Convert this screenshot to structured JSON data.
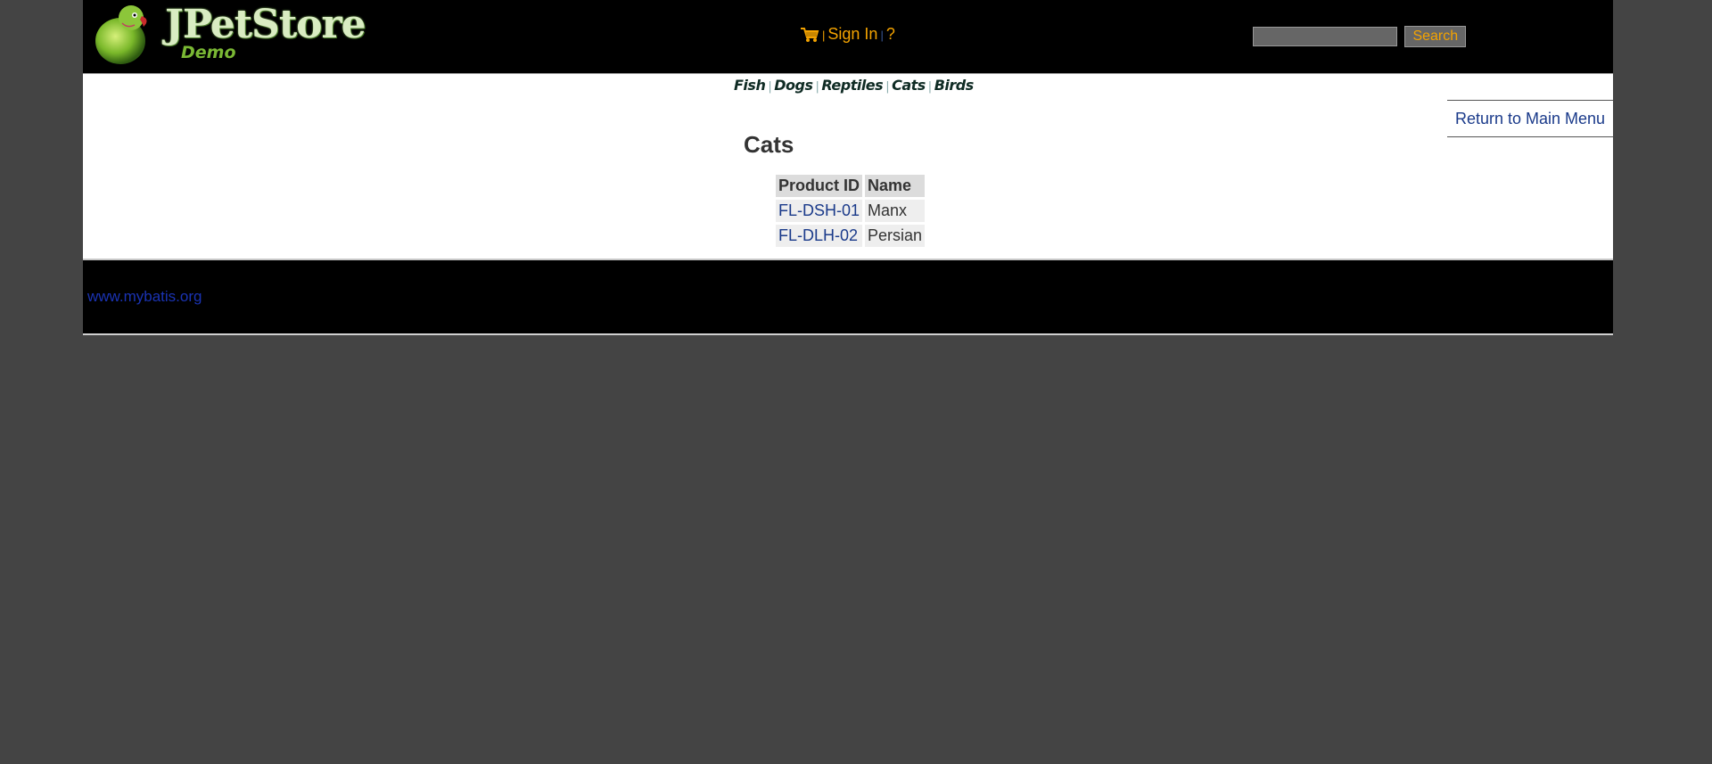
{
  "header": {
    "logo": {
      "title": "JPetStore",
      "subtitle": "Demo"
    },
    "menu": {
      "cart_icon": "cart-icon",
      "sign_in": "Sign In",
      "help": "?",
      "separator": "|"
    },
    "search": {
      "value": "",
      "placeholder": "",
      "button_label": "Search"
    }
  },
  "quicklinks": [
    "Fish",
    "Dogs",
    "Reptiles",
    "Cats",
    "Birds"
  ],
  "back_link": "Return to Main Menu",
  "catalog": {
    "title": "Cats",
    "columns": [
      "Product ID",
      "Name"
    ],
    "rows": [
      {
        "id": "FL-DSH-01",
        "name": "Manx"
      },
      {
        "id": "FL-DLH-02",
        "name": "Persian"
      }
    ]
  },
  "footer": {
    "link": "www.mybatis.org"
  },
  "colors": {
    "background": "#444444",
    "header": "#000000",
    "menu_accent": "#f4a300",
    "link": "#1a3a8a",
    "footer_link": "#1a33b3"
  }
}
